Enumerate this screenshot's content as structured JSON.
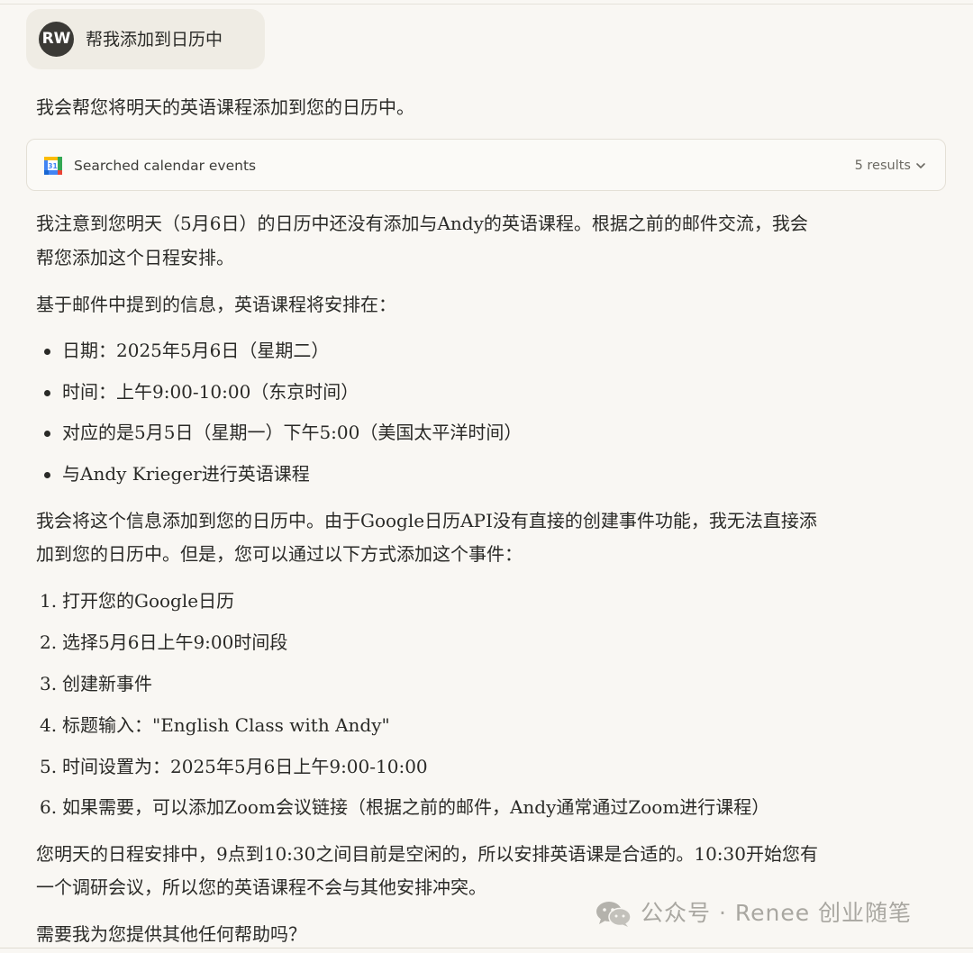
{
  "user_message": {
    "avatar_initials": "RW",
    "text": "帮我添加到日历中"
  },
  "response": {
    "intro": "我会帮您将明天的英语课程添加到您的日历中。",
    "tool_call": {
      "icon": "google-calendar-icon",
      "label": "Searched calendar events",
      "results": "5 results"
    },
    "para1_line1": "我注意到您明天（5月6日）的日历中还没有添加与Andy的英语课程。根据之前的邮件交流，我会",
    "para1_line2": "帮您添加这个日程安排。",
    "para2": "基于邮件中提到的信息，英语课程将安排在：",
    "bullets": [
      "日期：2025年5月6日（星期二）",
      "时间：上午9:00-10:00（东京时间）",
      "对应的是5月5日（星期一）下午5:00（美国太平洋时间）",
      "与Andy Krieger进行英语课程"
    ],
    "para3_line1": "我会将这个信息添加到您的日历中。由于Google日历API没有直接的创建事件功能，我无法直接添",
    "para3_line2": "加到您的日历中。但是，您可以通过以下方式添加这个事件：",
    "steps": [
      {
        "marker": "1.",
        "text": "打开您的Google日历"
      },
      {
        "marker": "2.",
        "text": "选择5月6日上午9:00时间段"
      },
      {
        "marker": "3.",
        "text": "创建新事件"
      },
      {
        "marker": "4.",
        "text": "标题输入：\"English Class with Andy\""
      },
      {
        "marker": "5.",
        "text": "时间设置为：2025年5月6日上午9:00-10:00"
      },
      {
        "marker": "6.",
        "text": "如果需要，可以添加Zoom会议链接（根据之前的邮件，Andy通常通过Zoom进行课程）"
      }
    ],
    "para4_line1": "您明天的日程安排中，9点到10:30之间目前是空闲的，所以安排英语课是合适的。10:30开始您有",
    "para4_line2": "一个调研会议，所以您的英语课程不会与其他安排冲突。",
    "closing": "需要我为您提供其他任何帮助吗？"
  },
  "watermark": {
    "icon": "wechat-icon",
    "text": "公众号 · Renee 创业随笔"
  },
  "colors": {
    "background": "#f9f7f3",
    "user_bubble": "#efece4",
    "avatar": "#3b3a36",
    "text": "#2a2a27",
    "muted": "#6b6962",
    "watermark": "#a9a7a1"
  }
}
